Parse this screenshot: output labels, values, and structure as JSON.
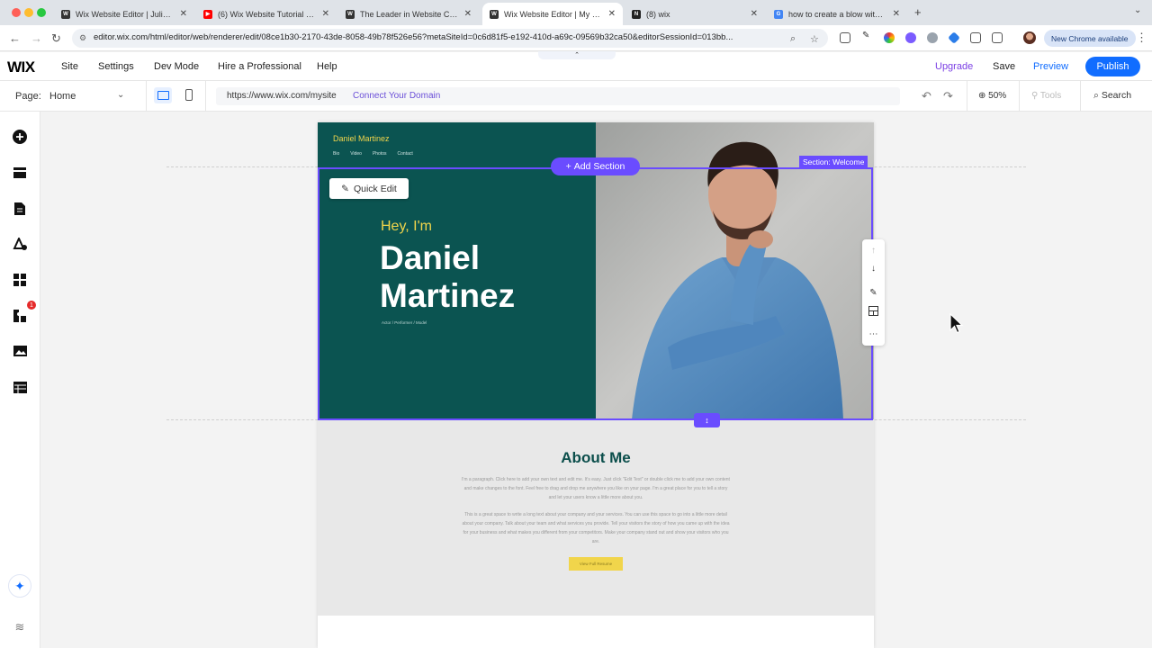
{
  "browser": {
    "tabs": [
      {
        "label": "Wix Website Editor | Juliamw...",
        "favicon": "wix-icon",
        "active": false
      },
      {
        "label": "(6) Wix Website Tutorial - Yo...",
        "favicon": "youtube-icon",
        "active": false
      },
      {
        "label": "The Leader in Website Creati...",
        "favicon": "wix-icon",
        "active": false
      },
      {
        "label": "Wix Website Editor | My Site",
        "favicon": "wix-icon",
        "active": true
      },
      {
        "label": "(8) wix",
        "favicon": "notion-icon",
        "active": false
      },
      {
        "label": "how to create a blow with wix",
        "favicon": "google-icon",
        "active": false
      }
    ],
    "url": "editor.wix.com/html/editor/web/renderer/edit/08ce1b30-2170-43de-8058-49b78f526e56?metaSiteId=0c6d81f5-e192-410d-a69c-09569b32ca50&editorSessionId=013bb...",
    "new_chrome_label": "New Chrome available"
  },
  "wix_top": {
    "logo": "WIX",
    "menu": [
      "Site",
      "Settings",
      "Dev Mode",
      "Hire a Professional",
      "Help"
    ],
    "upgrade": "Upgrade",
    "save": "Save",
    "preview": "Preview",
    "publish": "Publish"
  },
  "wix_bar2": {
    "page_label": "Page:",
    "page_name": "Home",
    "site_url": "https://www.wix.com/mysite",
    "connect_domain": "Connect Your Domain",
    "zoom": "50%",
    "tools": "Tools",
    "search": "Search"
  },
  "left_rail": {
    "items": [
      "add-elements-icon",
      "add-section-icon",
      "pages-icon",
      "site-design-icon",
      "add-apps-icon",
      "business-apps-icon",
      "media-icon",
      "cms-icon"
    ],
    "badge": "1"
  },
  "site": {
    "brand": "Daniel Martinez",
    "nav": [
      "Bio",
      "Video",
      "Photos",
      "Contact"
    ],
    "hey": "Hey, I'm",
    "name": "Daniel Martinez",
    "subtitle": "Actor / Performer / Model",
    "about_title": "About Me",
    "about_p1": "I'm a paragraph. Click here to add your own text and edit me. It's easy. Just click \"Edit Text\" or double click me to add your own content and make changes to the font. Feel free to drag and drop me anywhere you like on your page. I'm a great place for you to tell a story and let your users know a little more about you.",
    "about_p2": "This is a great space to write a long text about your company and your services. You can use this space to go into a little more detail about your company. Talk about your team and what services you provide. Tell your visitors the story of how you came up with the idea for your business and what makes you different from your competitors. Make your company stand out and show your visitors who you are.",
    "resume_button": "View Full Resume"
  },
  "editor_overlay": {
    "add_section": "Add Section",
    "section_label": "Section: Welcome",
    "quick_edit": "Quick Edit",
    "accent": "#6a4cff"
  }
}
